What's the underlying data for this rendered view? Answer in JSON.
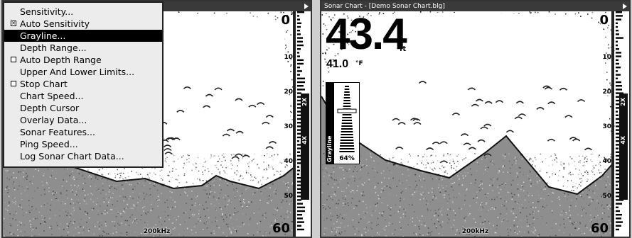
{
  "menu": {
    "items": [
      {
        "label": "Sensitivity...",
        "checkbox": null,
        "highlighted": false
      },
      {
        "label": "Auto Sensitivity",
        "checkbox": true,
        "highlighted": false
      },
      {
        "label": "Grayline...",
        "checkbox": null,
        "highlighted": true
      },
      {
        "label": "Depth Range...",
        "checkbox": null,
        "highlighted": false
      },
      {
        "label": "Auto Depth Range",
        "checkbox": false,
        "highlighted": false
      },
      {
        "label": "Upper And Lower Limits...",
        "checkbox": null,
        "highlighted": false
      },
      {
        "label": "Stop Chart",
        "checkbox": false,
        "highlighted": false
      },
      {
        "label": "Chart Speed...",
        "checkbox": null,
        "highlighted": false
      },
      {
        "label": "Depth Cursor",
        "checkbox": null,
        "highlighted": false
      },
      {
        "label": "Overlay Data...",
        "checkbox": null,
        "highlighted": false
      },
      {
        "label": "Sonar Features...",
        "checkbox": null,
        "highlighted": false
      },
      {
        "label": "Ping Speed...",
        "checkbox": null,
        "highlighted": false
      },
      {
        "label": "Log Sonar Chart Data...",
        "checkbox": null,
        "highlighted": false
      }
    ]
  },
  "left_panel": {
    "title": "",
    "frequency": "200kHz",
    "depth_scale": [
      "0",
      "10",
      "20",
      "30",
      "40",
      "50",
      "60"
    ],
    "zoom_labels": [
      "2X",
      "4X"
    ]
  },
  "right_panel": {
    "title": "Sonar Chart - [Demo Sonar Chart.blg]",
    "depth_value": "43.4",
    "depth_unit": "ft",
    "temperature_value": "41.0",
    "temperature_unit": "°F",
    "grayline_label": "Grayline",
    "grayline_percent": "64%",
    "grayline_level": 0.64,
    "frequency": "200kHz",
    "depth_scale": [
      "0",
      "10",
      "20",
      "30",
      "40",
      "50",
      "60"
    ],
    "zoom_labels": [
      "2X",
      "4X"
    ]
  },
  "colors": {
    "highlight": "#000000",
    "menu_background": "#ececec",
    "titlebar": "#3a3a3a"
  }
}
